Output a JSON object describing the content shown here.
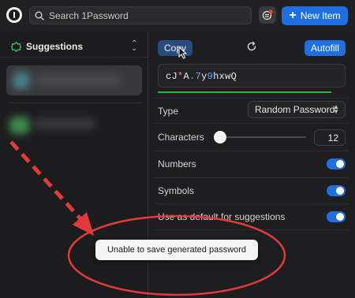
{
  "search": {
    "placeholder": "Search 1Password"
  },
  "header": {
    "new_item_label": "New Item",
    "new_item_icon": "plus-icon"
  },
  "sidebar": {
    "title": "Suggestions",
    "title_icon": "suggestions-icon"
  },
  "generator": {
    "copy_label": "Copy",
    "autofill_label": "Autofill",
    "password_parts": [
      {
        "t": "cJ",
        "k": "plain"
      },
      {
        "t": "*",
        "k": "sym"
      },
      {
        "t": "A",
        "k": "plain"
      },
      {
        "t": ".",
        "k": "sym"
      },
      {
        "t": "7",
        "k": "num"
      },
      {
        "t": "y",
        "k": "plain"
      },
      {
        "t": "9",
        "k": "num"
      },
      {
        "t": "hxwQ",
        "k": "plain"
      }
    ],
    "type_label": "Type",
    "type_value": "Random Password",
    "characters_label": "Characters",
    "characters_value": "12",
    "characters_fraction": 0.0,
    "numbers_label": "Numbers",
    "numbers_on": true,
    "symbols_label": "Symbols",
    "symbols_on": true,
    "default_label": "Use as default for suggestions",
    "default_on": true
  },
  "toast": {
    "message": "Unable to save generated password"
  },
  "colors": {
    "accent": "#1f6fe0",
    "annotation": "#e03a3a",
    "strength": "#2fb344",
    "symbol": "#ff7d8a",
    "number": "#66a6ff"
  }
}
